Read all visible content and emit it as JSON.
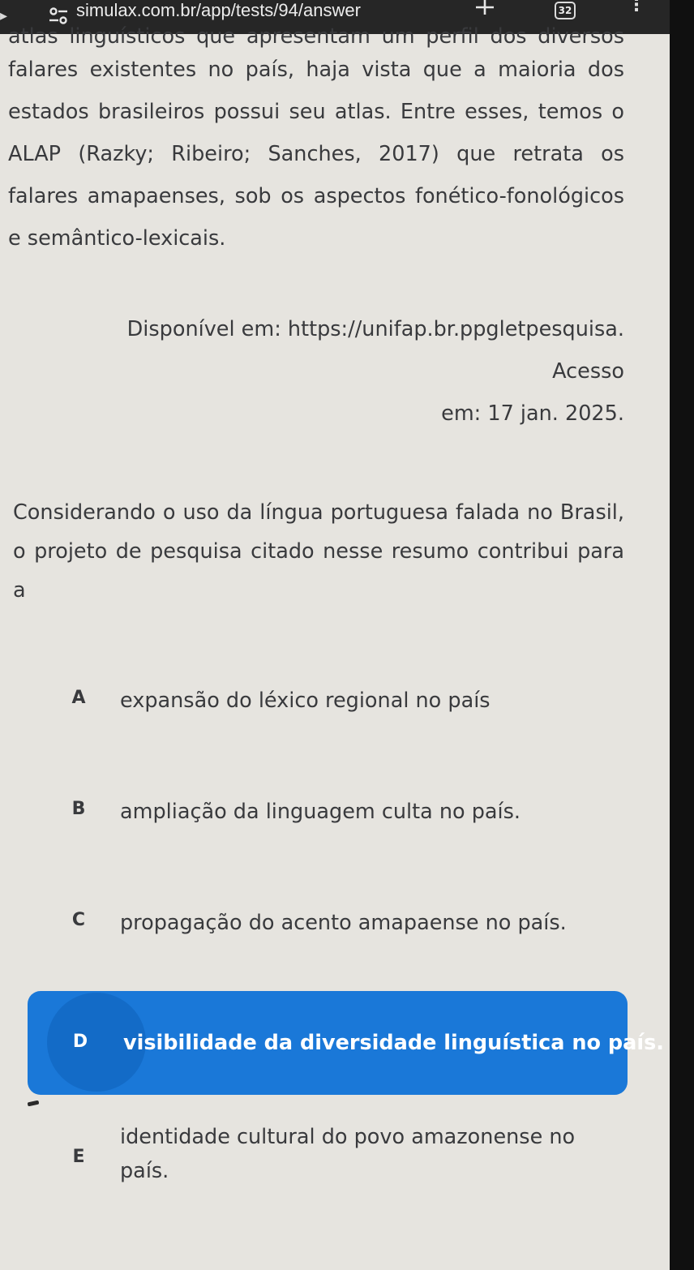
{
  "browser": {
    "url": "simulax.com.br/app/tests/94/answer",
    "tab_count": "32"
  },
  "passage": {
    "cut_line": "atlas linguísticos que apresentam um perfil dos diversos",
    "text": "falares existentes no país, haja vista que a maioria dos estados brasileiros possui seu atlas. Entre esses, temos o ALAP (Razky; Ribeiro; Sanches, 2017) que retrata os falares amapaenses, sob os aspectos fonético-fonológicos e semântico-lexicais."
  },
  "source": {
    "line1": "Disponível em: https://unifap.br.ppgletpesquisa. Acesso",
    "line2": "em: 17 jan. 2025."
  },
  "question": {
    "text": "Considerando o uso da língua portuguesa falada no Brasil, o projeto de pesquisa citado nesse resumo contribui para a"
  },
  "options": [
    {
      "letter": "A",
      "text": "expansão do léxico regional no país",
      "selected": false
    },
    {
      "letter": "B",
      "text": "ampliação da linguagem culta no país.",
      "selected": false
    },
    {
      "letter": "C",
      "text": "propagação do acento amapaense no país.",
      "selected": false
    },
    {
      "letter": "D",
      "text": "visibilidade da diversidade linguística no país.",
      "selected": true
    },
    {
      "letter": "E",
      "text_line1": "identidade cultural do povo amazonense no",
      "text_line2": "país.",
      "selected": false
    }
  ],
  "colors": {
    "page_background": "#e6e4df",
    "text": "#393a3d",
    "selected_background": "#1a78d8",
    "selected_circle": "#136bc7",
    "address_bar": "#262626"
  },
  "icons": {
    "back": "chevron-left-icon",
    "site": "site-settings-icon",
    "new_tab": "plus-icon",
    "tabs": "tab-switcher-icon",
    "menu": "more-vertical-icon"
  }
}
